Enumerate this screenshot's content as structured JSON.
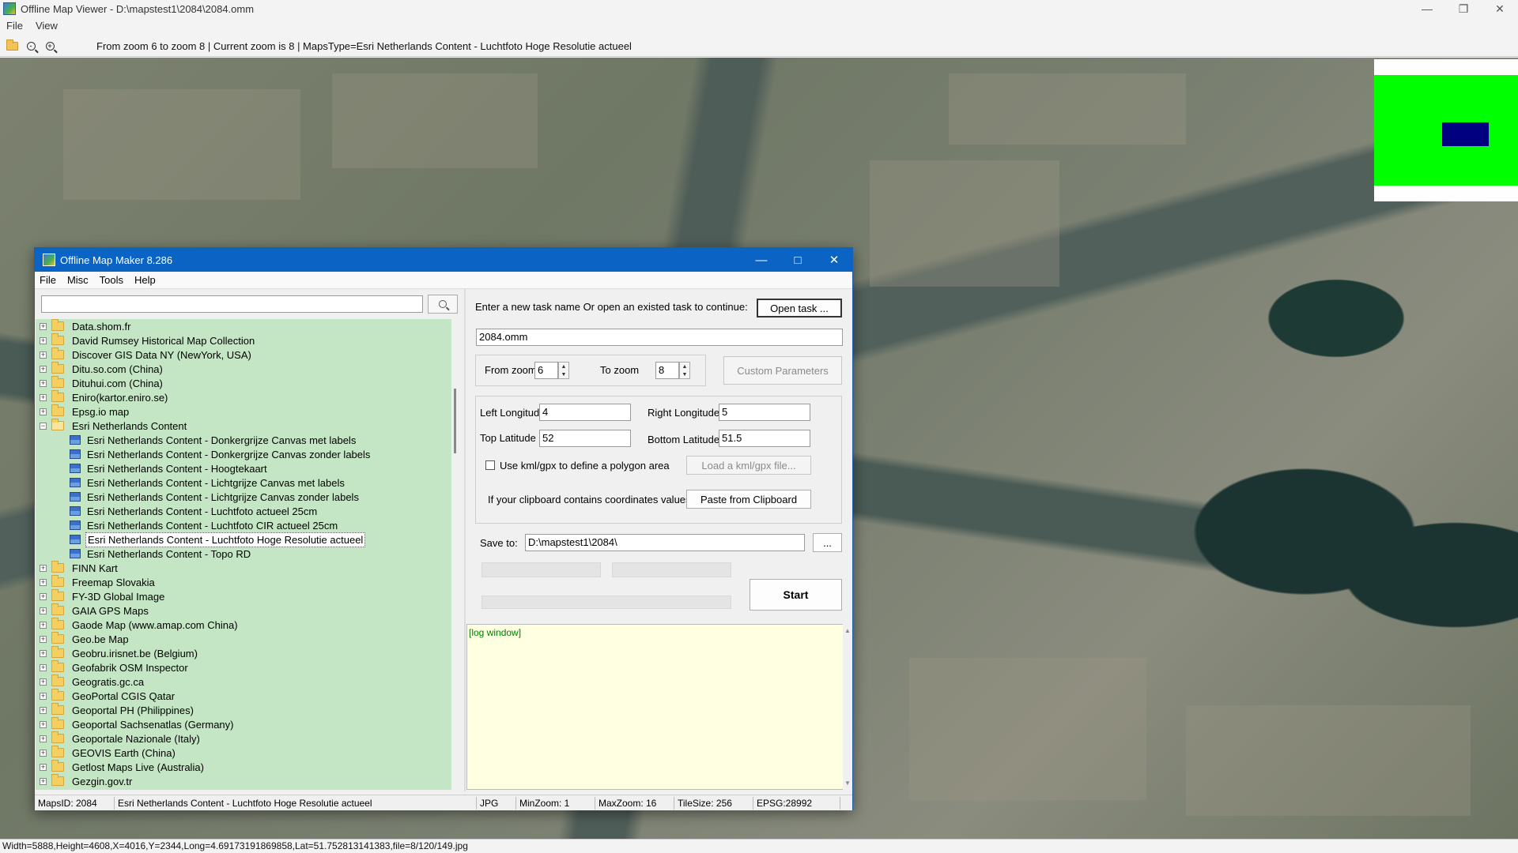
{
  "viewer": {
    "title": "Offline Map Viewer - D:\\mapstest1\\2084\\2084.omm",
    "menu": [
      "File",
      "View"
    ],
    "toolbar_info": "From zoom 6 to zoom 8   |   Current zoom is 8  |   MapsType=Esri Netherlands Content - Luchtfoto Hoge Resolutie actueel",
    "status": "Width=5888,Height=4608,X=4016,Y=2344,Long=4.69173191869858,Lat=51.752813141383,file=8/120/149.jpg",
    "colors": {
      "minimap_bg": "#00ff00",
      "minimap_viewport": "#000080"
    }
  },
  "dialog": {
    "title": "Offline Map Maker 8.286",
    "menu": [
      "File",
      "Misc",
      "Tools",
      "Help"
    ],
    "search": {
      "value": "",
      "placeholder": ""
    },
    "tree": [
      {
        "label": "Data.shom.fr",
        "type": "folder"
      },
      {
        "label": "David Rumsey Historical Map Collection",
        "type": "folder"
      },
      {
        "label": "Discover GIS Data NY (NewYork, USA)",
        "type": "folder"
      },
      {
        "label": "Ditu.so.com (China)",
        "type": "folder"
      },
      {
        "label": "Dituhui.com (China)",
        "type": "folder"
      },
      {
        "label": "Eniro(kartor.eniro.se)",
        "type": "folder"
      },
      {
        "label": "Epsg.io map",
        "type": "folder"
      },
      {
        "label": "Esri Netherlands Content",
        "type": "folder-open"
      },
      {
        "label": "Esri Netherlands Content - Donkergrijze Canvas met labels",
        "type": "map"
      },
      {
        "label": "Esri Netherlands Content - Donkergrijze Canvas zonder labels",
        "type": "map"
      },
      {
        "label": "Esri Netherlands Content - Hoogtekaart",
        "type": "map"
      },
      {
        "label": "Esri Netherlands Content - Lichtgrijze Canvas met labels",
        "type": "map"
      },
      {
        "label": "Esri Netherlands Content - Lichtgrijze Canvas zonder labels",
        "type": "map"
      },
      {
        "label": "Esri Netherlands Content - Luchtfoto actueel 25cm",
        "type": "map"
      },
      {
        "label": "Esri Netherlands Content - Luchtfoto CIR actueel 25cm",
        "type": "map"
      },
      {
        "label": "Esri Netherlands Content - Luchtfoto Hoge Resolutie actueel",
        "type": "map",
        "selected": true
      },
      {
        "label": "Esri Netherlands Content - Topo RD",
        "type": "map"
      },
      {
        "label": "FINN Kart",
        "type": "folder"
      },
      {
        "label": "Freemap Slovakia",
        "type": "folder"
      },
      {
        "label": "FY-3D Global Image",
        "type": "folder"
      },
      {
        "label": "GAIA GPS Maps",
        "type": "folder"
      },
      {
        "label": "Gaode Map (www.amap.com China)",
        "type": "folder"
      },
      {
        "label": "Geo.be Map",
        "type": "folder"
      },
      {
        "label": "Geobru.irisnet.be (Belgium)",
        "type": "folder"
      },
      {
        "label": "Geofabrik OSM Inspector",
        "type": "folder"
      },
      {
        "label": "Geogratis.gc.ca",
        "type": "folder"
      },
      {
        "label": "GeoPortal CGIS Qatar",
        "type": "folder"
      },
      {
        "label": "Geoportal PH (Philippines)",
        "type": "folder"
      },
      {
        "label": "Geoportal Sachsenatlas (Germany)",
        "type": "folder"
      },
      {
        "label": "Geoportale Nazionale (Italy)",
        "type": "folder"
      },
      {
        "label": "GEOVIS Earth (China)",
        "type": "folder"
      },
      {
        "label": "Getlost Maps Live (Australia)",
        "type": "folder"
      },
      {
        "label": "Gezgin.gov.tr",
        "type": "folder"
      }
    ],
    "task_prompt": "Enter a new task name Or open an existed task to continue:",
    "open_task_label": "Open task ...",
    "task_name": "2084.omm",
    "from_zoom_label": "From zoom",
    "from_zoom_value": "6",
    "to_zoom_label": "To zoom",
    "to_zoom_value": "8",
    "custom_params_label": "Custom Parameters",
    "left_lon_label": "Left Longitude",
    "left_lon_value": "4",
    "right_lon_label": "Right Longitude",
    "right_lon_value": "5",
    "top_lat_label": "Top Latitude",
    "top_lat_value": "52",
    "bottom_lat_label": "Bottom Latitude",
    "bottom_lat_value": "51.5",
    "kml_checkbox_label": "Use kml/gpx to define a polygon area",
    "kml_checked": false,
    "load_kml_label": "Load a kml/gpx file...",
    "clipboard_prompt": "If your clipboard contains coordinates values:",
    "paste_label": "Paste from Clipboard",
    "save_to_label": "Save to:",
    "save_to_value": "D:\\mapstest1\\2084\\",
    "browse_label": "...",
    "start_label": "Start",
    "log_text": "[log window]",
    "status": {
      "maps_id": "MapsID: 2084",
      "maps_name": "Esri Netherlands Content - Luchtfoto Hoge Resolutie actueel",
      "format": "JPG",
      "min_zoom": "MinZoom: 1",
      "max_zoom": "MaxZoom: 16",
      "tile_size": "TileSize: 256",
      "epsg": "EPSG:28992"
    }
  }
}
